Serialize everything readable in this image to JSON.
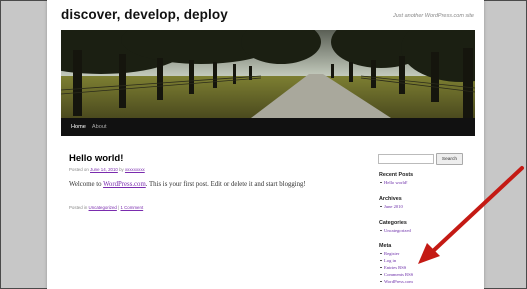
{
  "site": {
    "title": "discover, develop, deploy",
    "tagline": "Just another WordPress.com site"
  },
  "nav": {
    "items": [
      {
        "label": "Home",
        "active": true
      },
      {
        "label": "About",
        "active": false
      }
    ]
  },
  "post": {
    "title": "Hello world!",
    "meta_prefix": "Posted on",
    "meta_date": "June 14, 2010",
    "meta_by": "by",
    "meta_author": "xxxxxxxxx",
    "content_before": "Welcome to ",
    "content_link": "WordPress.com",
    "content_after": ". This is your first post. Edit or delete it and start blogging!",
    "footer_prefix": "Posted in",
    "footer_category": "Uncategorized",
    "footer_sep": "|",
    "footer_comments": "1 Comment"
  },
  "sidebar": {
    "search_button": "Search",
    "search_value": "",
    "recent_posts": {
      "title": "Recent Posts",
      "items": [
        "Hello world!"
      ]
    },
    "archives": {
      "title": "Archives",
      "items": [
        "June 2010"
      ]
    },
    "categories": {
      "title": "Categories",
      "items": [
        "Uncategorized"
      ]
    },
    "meta": {
      "title": "Meta",
      "items": [
        "Register",
        "Log in",
        "Entries RSS",
        "Comments RSS",
        "WordPress.com"
      ]
    }
  },
  "colors": {
    "arrow": "#c41a14",
    "link": "#6b2ca8",
    "nav_bg": "#111111"
  }
}
